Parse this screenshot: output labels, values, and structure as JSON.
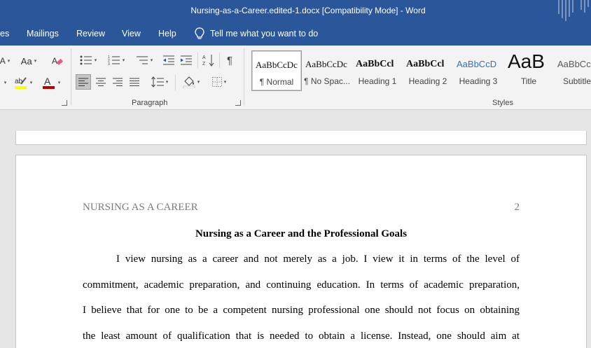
{
  "titlebar": {
    "title": "Nursing-as-a-Career.edited-1.docx [Compatibility Mode]  -  Word",
    "bg_color": "#2b579a"
  },
  "menu": {
    "items": [
      "es",
      "Mailings",
      "Review",
      "View",
      "Help"
    ],
    "tell_me": "Tell me what you want to do"
  },
  "ribbon": {
    "font_group": {
      "change_case_label": "Aa",
      "font_color_glyph": "A",
      "highlight_color": "#ffff00",
      "font_color": "#c00000"
    },
    "paragraph_group": {
      "label": "Paragraph",
      "pilcrow": "¶"
    },
    "styles_group": {
      "label": "Styles",
      "styles": [
        {
          "sample": "AaBbCcDc",
          "name": "¶ Normal"
        },
        {
          "sample": "AaBbCcDc",
          "name": "¶ No Spac..."
        },
        {
          "sample": "AaBbCcl",
          "name": "Heading 1"
        },
        {
          "sample": "AaBbCcl",
          "name": "Heading 2"
        },
        {
          "sample": "AaBbCcD",
          "name": "Heading 3"
        },
        {
          "sample": "AaB",
          "name": "Title"
        },
        {
          "sample": "AaBbCc",
          "name": "Subtitle"
        }
      ],
      "heading3_color": "#2e74b5"
    }
  },
  "document": {
    "running_head": "NURSING AS A CAREER",
    "page_number": "2",
    "heading": "Nursing as a Career and the Professional Goals",
    "lines": [
      "I view nursing as a career and not merely as a job. I view it in terms of the level of",
      "commitment, academic preparation, and continuing education.  In terms of academic preparation,",
      "I believe that for one to be a competent nursing professional one should not focus on obtaining",
      "the least amount of qualification that is needed to obtain a license. Instead, one should aim at"
    ]
  }
}
